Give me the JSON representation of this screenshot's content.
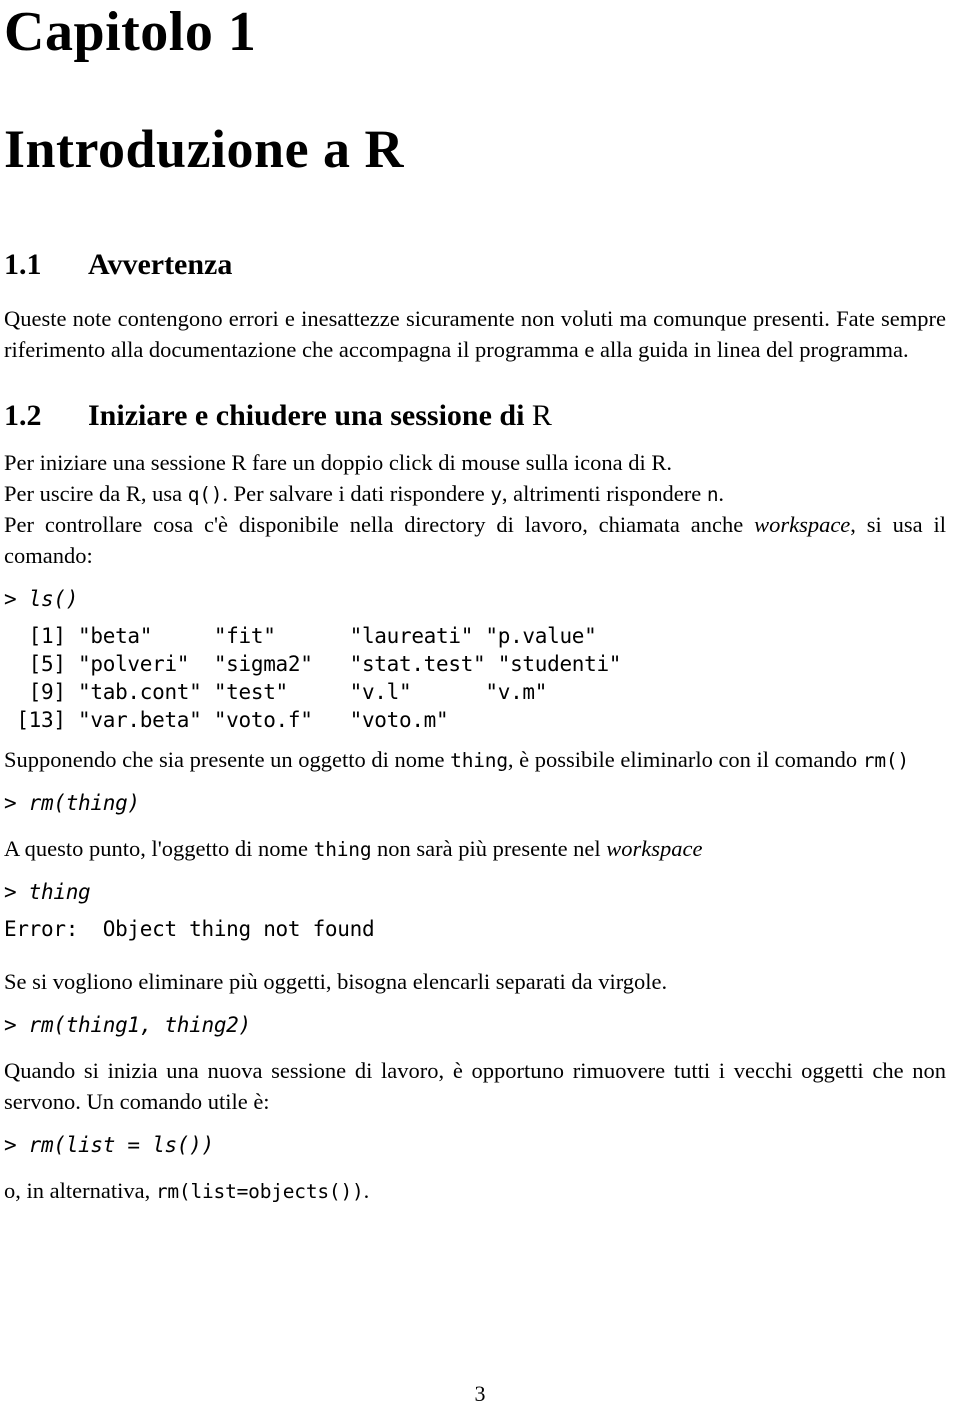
{
  "document": {
    "chapter_number": "Capitolo 1",
    "chapter_title": "Introduzione a R",
    "page_number": "3"
  },
  "sections": {
    "avvertenza": {
      "number": "1.1",
      "title": "Avvertenza",
      "paragraph": "Queste note contengono errori e inesattezze sicuramente non voluti ma comunque presenti. Fate sempre riferimento alla documentazione che accompagna il programma e alla guida in linea del programma."
    },
    "sessione": {
      "number": "1.2",
      "title_before_R": "Iniziare e chiudere una sessione di",
      "title_R": "R"
    }
  },
  "content": {
    "p1_line1": "Per iniziare una sessione R fare un doppio click di mouse sulla icona di R.",
    "p1_line2_a": "Per uscire da R, usa",
    "p1_line2_code1": "q()",
    "p1_line2_b": ". Per salvare i dati rispondere",
    "p1_line2_code2": "y",
    "p1_line2_c": ", altrimenti rispondere",
    "p1_line2_code3": "n",
    "p1_line2_d": ".",
    "p1_line3_a": "Per controllare cosa c'è disponibile nella directory di lavoro, chiamata anche",
    "p1_line3_italic": "workspace",
    "p1_line3_b": ", si usa il comando:",
    "cmd_ls": "> ls()",
    "ls_output": "  [1] \"beta\"     \"fit\"      \"laureati\" \"p.value\"\n  [5] \"polveri\"  \"sigma2\"   \"stat.test\" \"studenti\"\n  [9] \"tab.cont\" \"test\"     \"v.l\"      \"v.m\"\n [13] \"var.beta\" \"voto.f\"   \"voto.m\"",
    "p2_a": "Supponendo che sia presente un oggetto di nome",
    "p2_code1": "thing",
    "p2_b": ", è possibile eliminarlo con il comando",
    "p2_code2": "rm()",
    "cmd_rm_thing": "> rm(thing)",
    "p3_a": "A questo punto, l'oggetto di nome",
    "p3_code1": "thing",
    "p3_b": "non sarà più presente nel",
    "p3_italic": "workspace",
    "cmd_thing": "> thing",
    "output_error": "Error:  Object thing not found",
    "p4": "Se si vogliono eliminare più oggetti, bisogna elencarli separati da virgole.",
    "cmd_rm_two": "> rm(thing1, thing2)",
    "p5": "Quando si inizia una nuova sessione di lavoro, è opportuno rimuovere tutti i vecchi oggetti che non servono. Un comando utile è:",
    "cmd_rm_list": "> rm(list = ls())",
    "p6_a": "o, in alternativa,",
    "p6_code": "rm(list=objects())",
    "p6_b": "."
  },
  "colors": {
    "text": "#000000",
    "background": "#ffffff"
  }
}
